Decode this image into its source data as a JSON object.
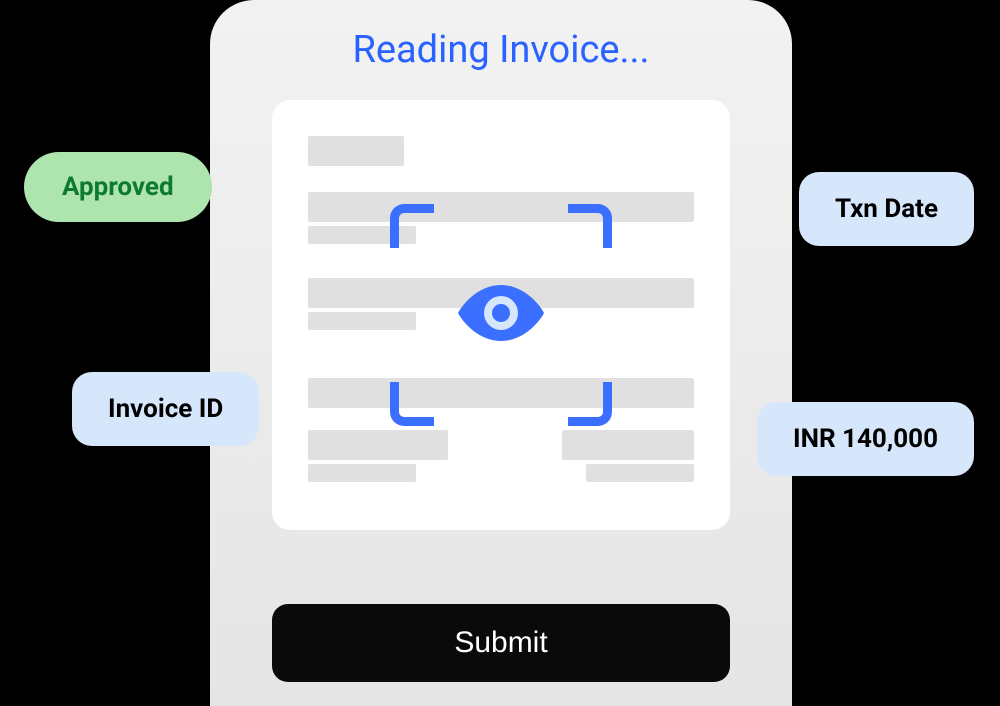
{
  "title": "Reading Invoice...",
  "submit_label": "Submit",
  "pills": {
    "approved": "Approved",
    "invoice_id": "Invoice ID",
    "txn_date": "Txn Date",
    "amount": "INR 140,000"
  }
}
